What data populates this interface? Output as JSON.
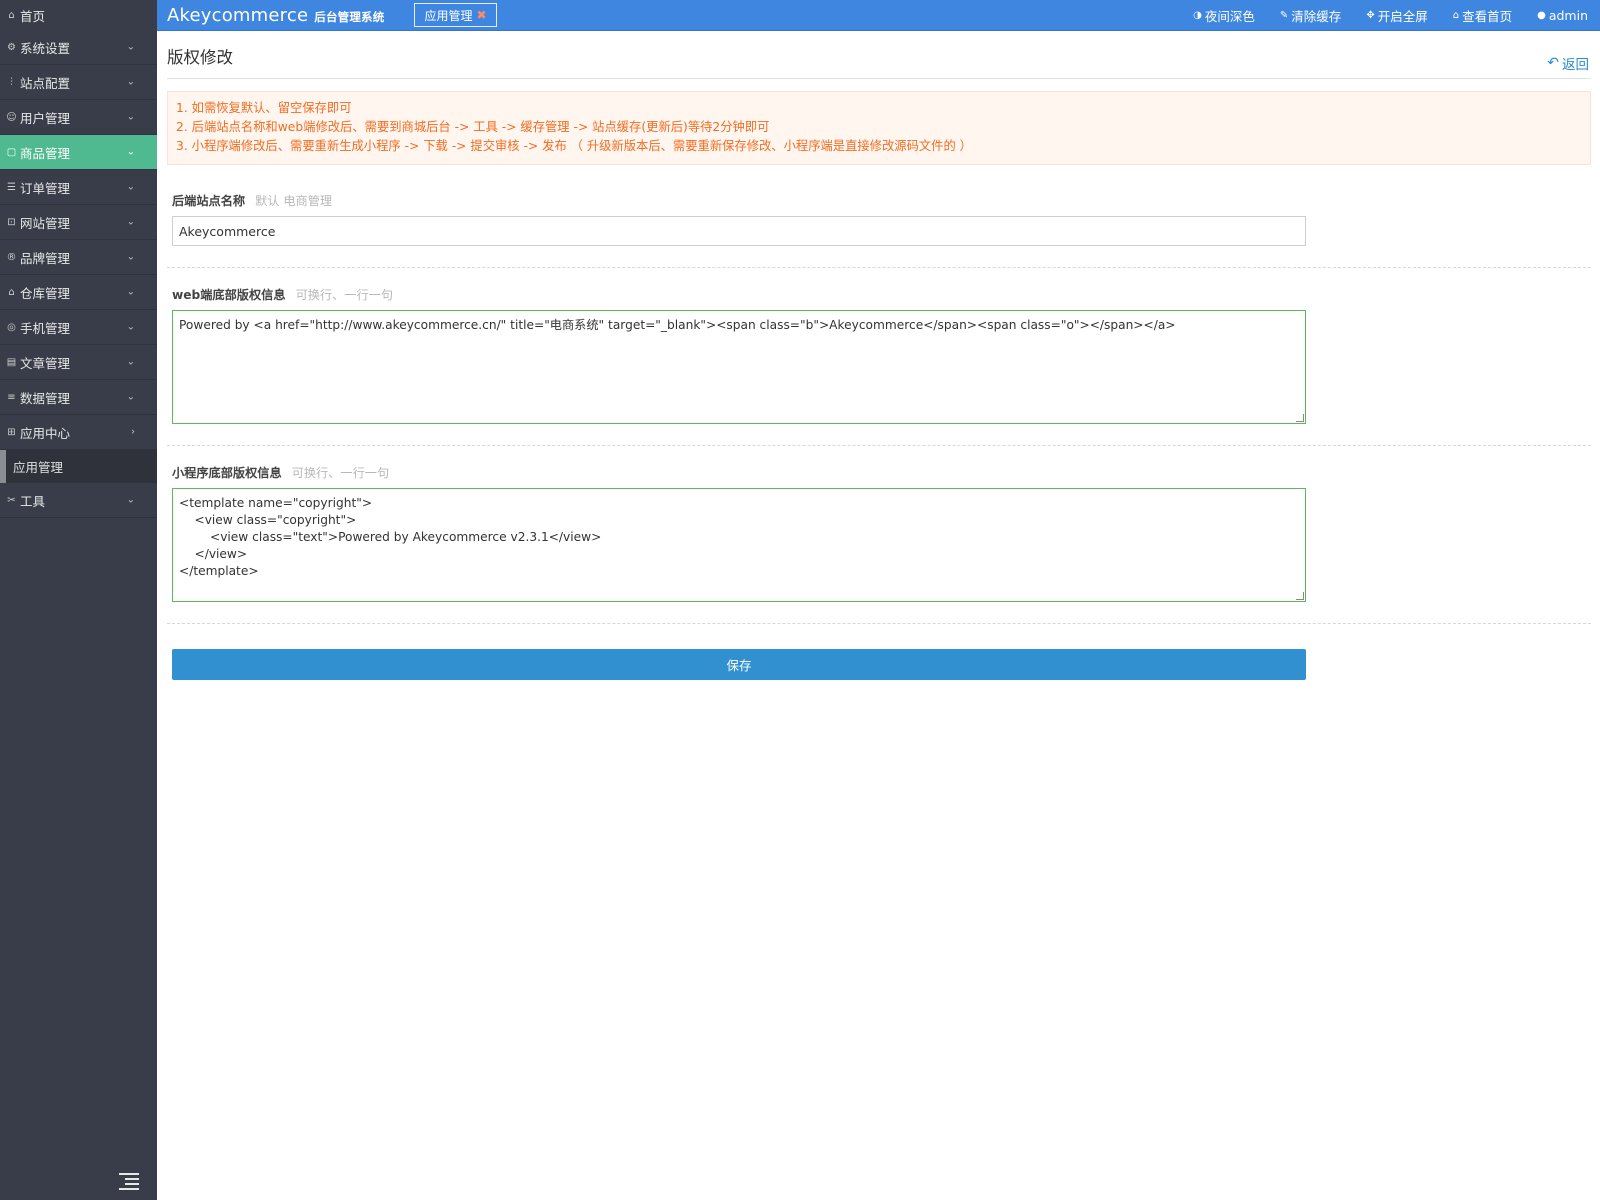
{
  "header": {
    "brand": "Akeycommerce",
    "brand_sub": "后台管理系统",
    "open_tab": "应用管理",
    "links": [
      {
        "icon": "contrast-icon",
        "label": "夜间深色"
      },
      {
        "icon": "brush-icon",
        "label": "清除缓存"
      },
      {
        "icon": "fullscreen-icon",
        "label": "开启全屏"
      },
      {
        "icon": "home-icon",
        "label": "查看首页"
      },
      {
        "icon": "user-icon",
        "label": "admin"
      }
    ]
  },
  "sidebar": {
    "home": "首页",
    "items": [
      {
        "label": "系统设置",
        "icon": "gear-icon"
      },
      {
        "label": "站点配置",
        "icon": "sliders-icon"
      },
      {
        "label": "用户管理",
        "icon": "user-icon"
      },
      {
        "label": "商品管理",
        "icon": "goods-icon"
      },
      {
        "label": "订单管理",
        "icon": "order-icon"
      },
      {
        "label": "网站管理",
        "icon": "website-icon"
      },
      {
        "label": "品牌管理",
        "icon": "brand-icon"
      },
      {
        "label": "仓库管理",
        "icon": "warehouse-icon"
      },
      {
        "label": "手机管理",
        "icon": "mobile-icon"
      },
      {
        "label": "文章管理",
        "icon": "article-icon"
      },
      {
        "label": "数据管理",
        "icon": "database-icon"
      },
      {
        "label": "应用中心",
        "icon": "apps-icon"
      }
    ],
    "sub_item": "应用管理",
    "tools": "工具"
  },
  "page": {
    "title": "版权修改",
    "back": "返回",
    "tips": [
      "1. 如需恢复默认、留空保存即可",
      "2. 后端站点名称和web端修改后、需要到商城后台 -> 工具 -> 缓存管理 -> 站点缓存(更新后)等待2分钟即可",
      "3. 小程序端修改后、需要重新生成小程序 -> 下载 -> 提交审核 -> 发布  （ 升级新版本后、需要重新保存修改、小程序端是直接修改源码文件的 ）"
    ],
    "site_name": {
      "label": "后端站点名称",
      "hint": "默认 电商管理",
      "value": "Akeycommerce"
    },
    "web_copyright": {
      "label": "web端底部版权信息",
      "hint": "可换行、一行一句",
      "value": "Powered by <a href=\"http://www.akeycommerce.cn/\" title=\"电商系统\" target=\"_blank\"><span class=\"b\">Akeycommerce</span><span class=\"o\"></span></a>"
    },
    "mini_copyright": {
      "label": "小程序底部版权信息",
      "hint": "可换行、一行一句",
      "value": "<template name=\"copyright\">\n    <view class=\"copyright\">\n        <view class=\"text\">Powered by Akeycommerce v2.3.1</view>\n    </view>\n</template>"
    },
    "save": "保存"
  }
}
